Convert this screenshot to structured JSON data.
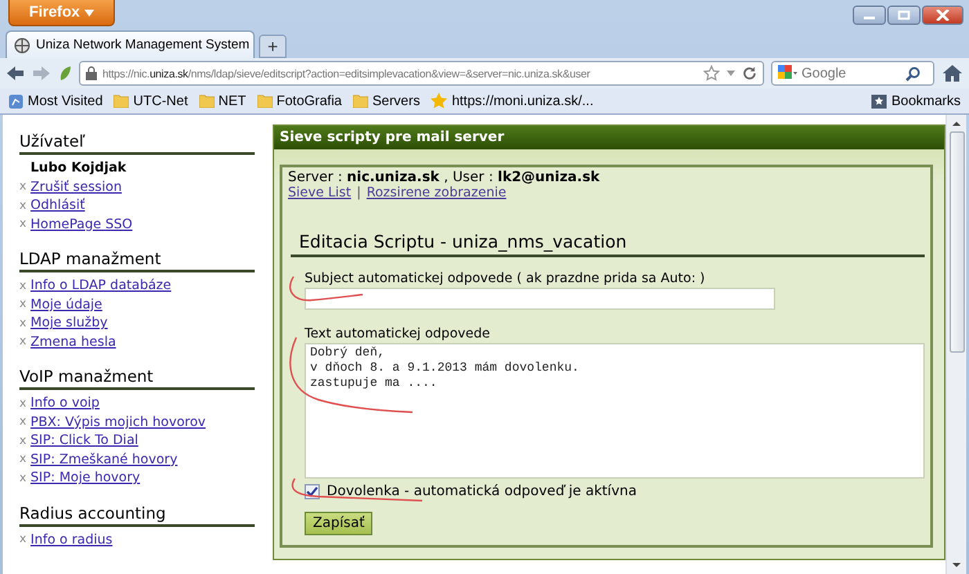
{
  "browser": {
    "app_button": "Firefox",
    "tab_title": "Uniza Network Management System",
    "new_tab": "+",
    "url_prefix": "https://nic.",
    "url_domain": "uniza.sk",
    "url_rest": "/nms/ldap/sieve/editscript?action=editsimplevacation&view=&server=nic.uniza.sk&user",
    "search_placeholder": "Google",
    "bookmarks": [
      {
        "label": "Most Visited",
        "kind": "special"
      },
      {
        "label": "UTC-Net",
        "kind": "folder"
      },
      {
        "label": "NET",
        "kind": "folder"
      },
      {
        "label": "FotoGrafia",
        "kind": "folder"
      },
      {
        "label": "Servers",
        "kind": "folder"
      },
      {
        "label": "https://moni.uniza.sk/...",
        "kind": "star"
      }
    ],
    "bookmarks_menu": "Bookmarks"
  },
  "sidebar": [
    {
      "title": "Užívateľ",
      "items": [
        {
          "kind": "name",
          "text": "Lubo Kojdjak"
        },
        {
          "kind": "link",
          "bullet": "x",
          "text": "Zrušiť session"
        },
        {
          "kind": "link",
          "bullet": "x",
          "text": "Odhlásiť"
        },
        {
          "kind": "link",
          "bullet": "x",
          "text": "HomePage SSO"
        }
      ]
    },
    {
      "title": "LDAP manažment",
      "items": [
        {
          "kind": "link",
          "bullet": "x",
          "text": "Info o LDAP databáze"
        },
        {
          "kind": "link",
          "bullet": "x",
          "text": "Moje údaje"
        },
        {
          "kind": "link",
          "bullet": "x",
          "text": "Moje služby"
        },
        {
          "kind": "link",
          "bullet": "x",
          "text": "Zmena hesla"
        }
      ]
    },
    {
      "title": "VoIP manažment",
      "items": [
        {
          "kind": "link",
          "bullet": "x",
          "text": "Info o voip"
        },
        {
          "kind": "link",
          "bullet": "x",
          "text": "PBX: Výpis mojich hovorov"
        },
        {
          "kind": "link",
          "bullet": "x",
          "text": "SIP: Click To Dial"
        },
        {
          "kind": "link",
          "bullet": "x",
          "text": "SIP: Zmeškané hovory"
        },
        {
          "kind": "link",
          "bullet": "x",
          "text": "SIP: Moje hovory"
        }
      ]
    },
    {
      "title": "Radius accounting",
      "items": [
        {
          "kind": "link",
          "bullet": "x",
          "text": "Info o radius"
        }
      ]
    }
  ],
  "panel": {
    "title": "Sieve scripty pre mail server",
    "server_line": "Server : **nic.uniza.sk** , User : **lk2@uniza.sk**",
    "links": [
      "Sieve List",
      "Rozsirene zobrazenie"
    ],
    "link_separator": "|",
    "heading": "Editacia Scriptu - uniza_nms_vacation",
    "subject_label": "Subject automatickej odpovede ( ak prazdne prida sa Auto: )",
    "text_label": "Text automatickej odpovede",
    "text_value": "Dobrý deň,\nv dňoch 8. a 9.1.2013 mám dovolenku.\nzastupuje ma ....",
    "vacation": {
      "label": "Dovolenka - automatická odpoveď je aktívna",
      "checked": true
    },
    "submit": "Zapísať"
  }
}
